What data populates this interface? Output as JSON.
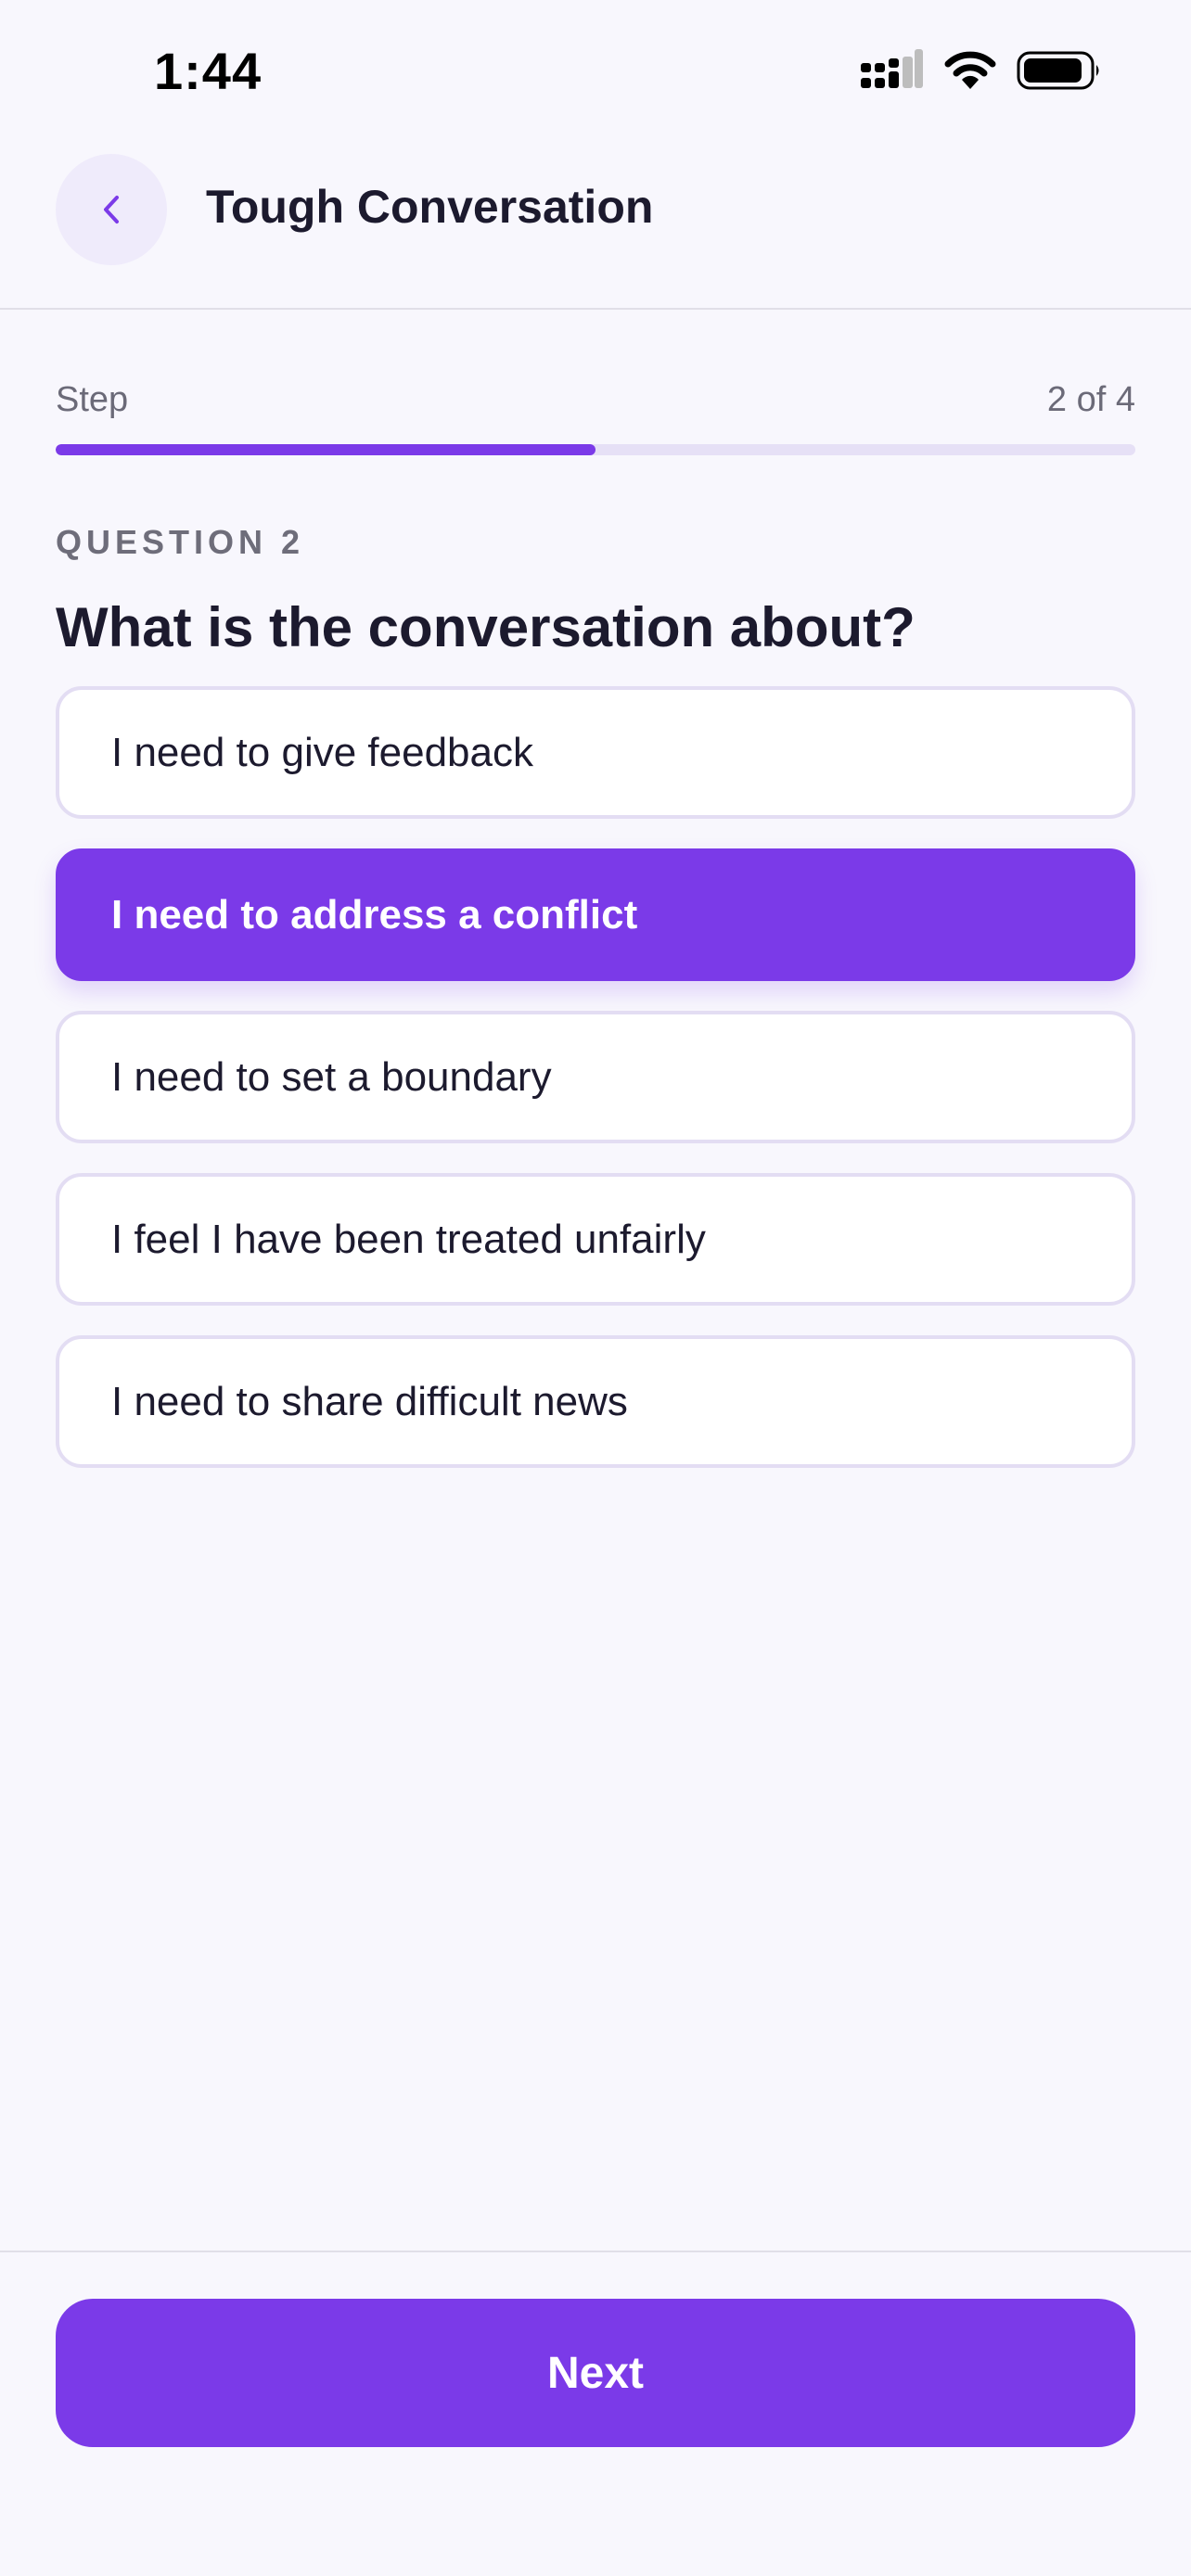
{
  "status_bar": {
    "time": "1:44",
    "icons": [
      "cellular-signal-icon",
      "wifi-icon",
      "battery-icon"
    ]
  },
  "header": {
    "back_icon": "chevron-left-icon",
    "title": "Tough Conversation"
  },
  "progress": {
    "label": "Step",
    "count": "2 of 4",
    "current_step": 2,
    "total_steps": 4,
    "fraction": 0.5
  },
  "question": {
    "eyebrow": "QUESTION 2",
    "text": "What is the conversation about?"
  },
  "options": [
    {
      "label": "I need to give feedback",
      "selected": false
    },
    {
      "label": "I need to address a conflict",
      "selected": true
    },
    {
      "label": "I need to set a boundary",
      "selected": false
    },
    {
      "label": "I feel I have been treated unfairly",
      "selected": false
    },
    {
      "label": "I need to share difficult news",
      "selected": false
    }
  ],
  "footer": {
    "next_label": "Next"
  },
  "colors": {
    "accent": "#7B3AE8",
    "background": "#F8F7FD",
    "text_primary": "#1C1A2E",
    "text_secondary": "#6B6A78",
    "option_border": "#E3DDF3",
    "track": "#E6E0F6"
  }
}
